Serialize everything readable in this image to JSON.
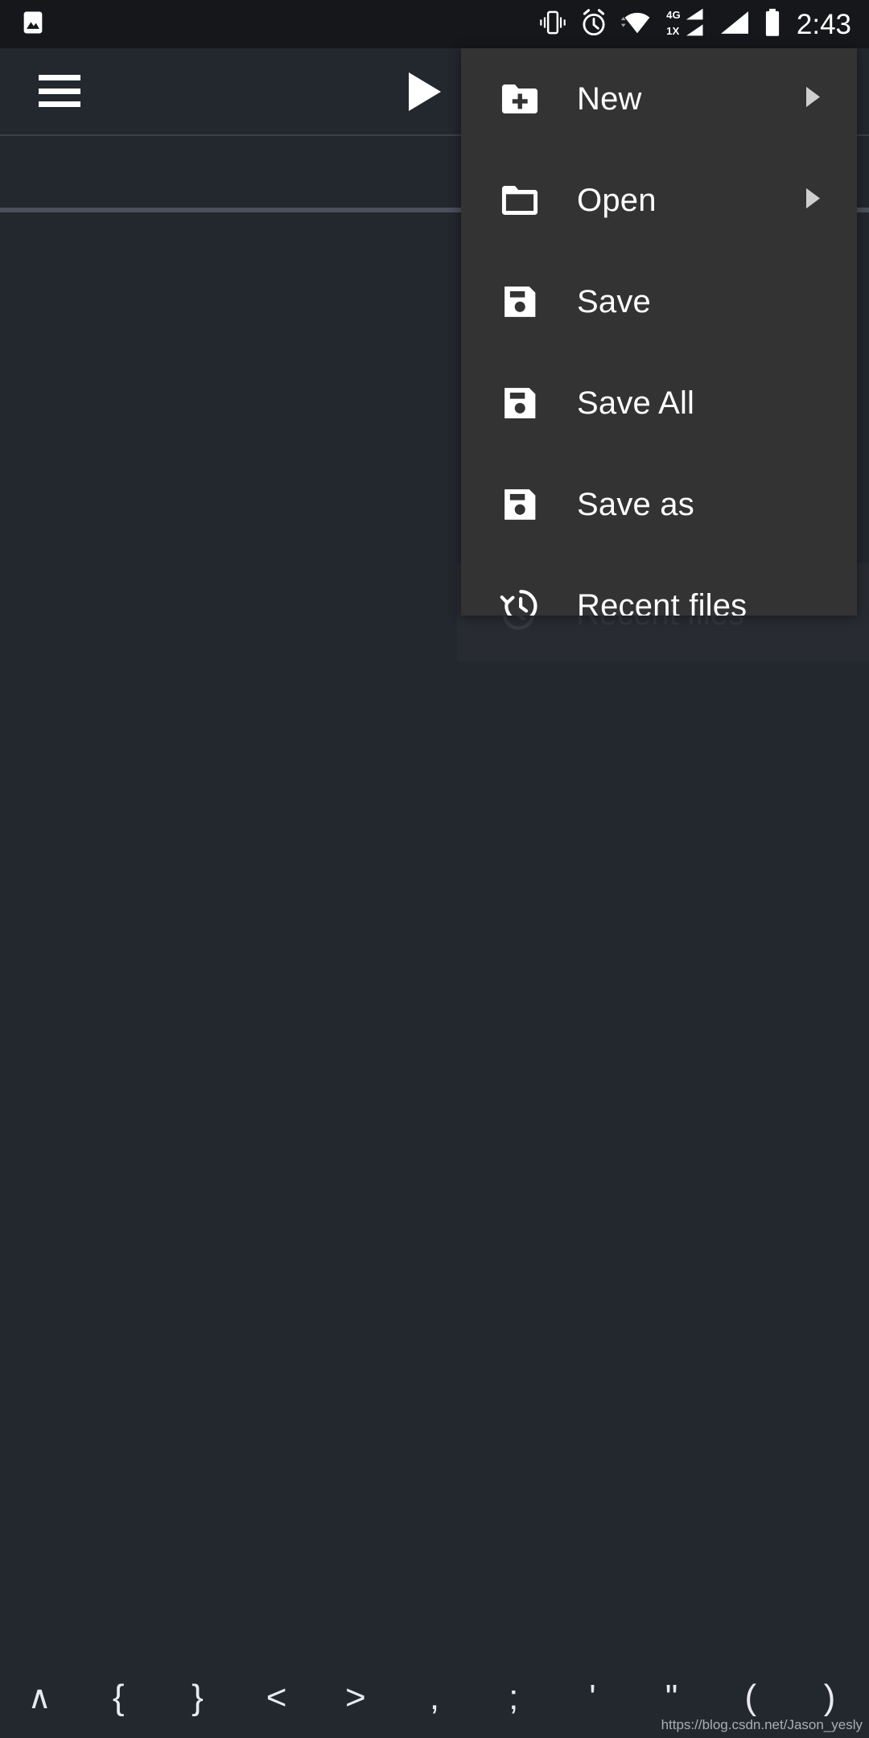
{
  "status_bar": {
    "left_icons": [
      {
        "name": "image-notification-icon"
      }
    ],
    "right_icons": [
      {
        "name": "vibrate-icon"
      },
      {
        "name": "alarm-clock-icon"
      },
      {
        "name": "wifi-icon"
      },
      {
        "name": "signal-4g-icon",
        "label_top": "4G",
        "label_bottom": "1X"
      },
      {
        "name": "signal-cellular-icon"
      },
      {
        "name": "battery-full-icon"
      }
    ],
    "clock": "2:43"
  },
  "toolbar": {
    "menu_button": "menu-icon",
    "run_button": "play-icon"
  },
  "file_menu": {
    "items": [
      {
        "label": "New",
        "icon": "folder-plus-icon",
        "has_submenu": true
      },
      {
        "label": "Open",
        "icon": "folder-icon",
        "has_submenu": true
      },
      {
        "label": "Save",
        "icon": "save-icon",
        "has_submenu": false
      },
      {
        "label": "Save All",
        "icon": "save-all-icon",
        "has_submenu": false
      },
      {
        "label": "Save as",
        "icon": "save-as-icon",
        "has_submenu": false
      },
      {
        "label": "Recent files",
        "icon": "history-icon",
        "has_submenu": false
      }
    ],
    "ghost_item": {
      "label": "Recent files",
      "icon": "history-icon"
    }
  },
  "symbol_bar": {
    "keys": [
      {
        "label": "∧",
        "name": "chevron-up-key"
      },
      {
        "label": "{",
        "name": "brace-open-key"
      },
      {
        "label": "}",
        "name": "brace-close-key"
      },
      {
        "label": "<",
        "name": "less-than-key"
      },
      {
        "label": ">",
        "name": "greater-than-key"
      },
      {
        "label": ",",
        "name": "comma-key"
      },
      {
        "label": ";",
        "name": "semicolon-key"
      },
      {
        "label": "'",
        "name": "apostrophe-key"
      },
      {
        "label": "\"",
        "name": "quote-key"
      },
      {
        "label": "(",
        "name": "paren-open-key"
      },
      {
        "label": ")",
        "name": "paren-close-key"
      }
    ]
  },
  "watermark": "https://blog.csdn.net/Jason_yesly",
  "colors": {
    "status_bar_bg": "#15171a",
    "app_bg": "#23272e",
    "menu_bg": "#333333",
    "text": "#ffffff",
    "divider": "#4a505a"
  }
}
